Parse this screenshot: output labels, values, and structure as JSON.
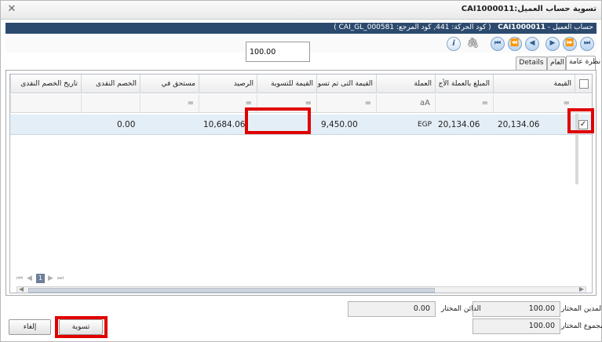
{
  "window": {
    "title": "تسوية حساب العميل:CAI1000011",
    "close_icon": "close-icon"
  },
  "header": {
    "customer_prefix": "حساب العميل - ",
    "customer_code": "CAI1000011",
    "details": "( كود الحركة: 441, كود المرجع: CAI_GL_000581 )",
    "bar_color": "#2c4a6e"
  },
  "toolbar": {
    "nav_icons": [
      "last-record-icon",
      "next-page-icon",
      "next-record-icon",
      "previous-record-icon",
      "previous-page-icon",
      "first-record-icon"
    ],
    "nav_glyphs": [
      "⏭",
      "⏩",
      "▶",
      "◀",
      "⏪",
      "⏮"
    ],
    "info_glyph": "i",
    "attach_glyph": "🖇"
  },
  "tabs": {
    "overview": "نظرة عامة",
    "general": "العام",
    "details": "Details"
  },
  "grid": {
    "columns": [
      "القيمة",
      "المبلغ بالعملة الأج",
      "العملة",
      "القيمة التى تم تسو",
      "القيمة للتسوية",
      "الرصيد",
      "مستحق في",
      "الخصم النقدى",
      "تاريخ الخصم النقدى"
    ],
    "filter_glyphs": [
      "=",
      "=",
      "aA",
      "=",
      "=",
      "=",
      "=",
      "",
      ""
    ],
    "row": {
      "selected": true,
      "value": "20,134.06",
      "foreign_amount": "20,134.06",
      "currency": "EGP",
      "settled_value": "9,450.00",
      "settle_input": "100.00",
      "balance": "10,684.06",
      "due_on": "",
      "cash_discount": "0.00",
      "discount_date": ""
    },
    "pager": {
      "first": "⏮",
      "prev": "◀",
      "current_page": "1",
      "next": "▶",
      "last": "⏭"
    }
  },
  "summary": {
    "selected_debit_label": "المدين المختار",
    "selected_debit": "100.00",
    "selected_credit_label": "الدائن المختار",
    "selected_credit": "0.00",
    "selected_total_label": "مجموع المختار",
    "selected_total": "100.00"
  },
  "buttons": {
    "settle": "تسوية",
    "cancel": "إلغاء"
  },
  "highlight_color": "#e00000"
}
